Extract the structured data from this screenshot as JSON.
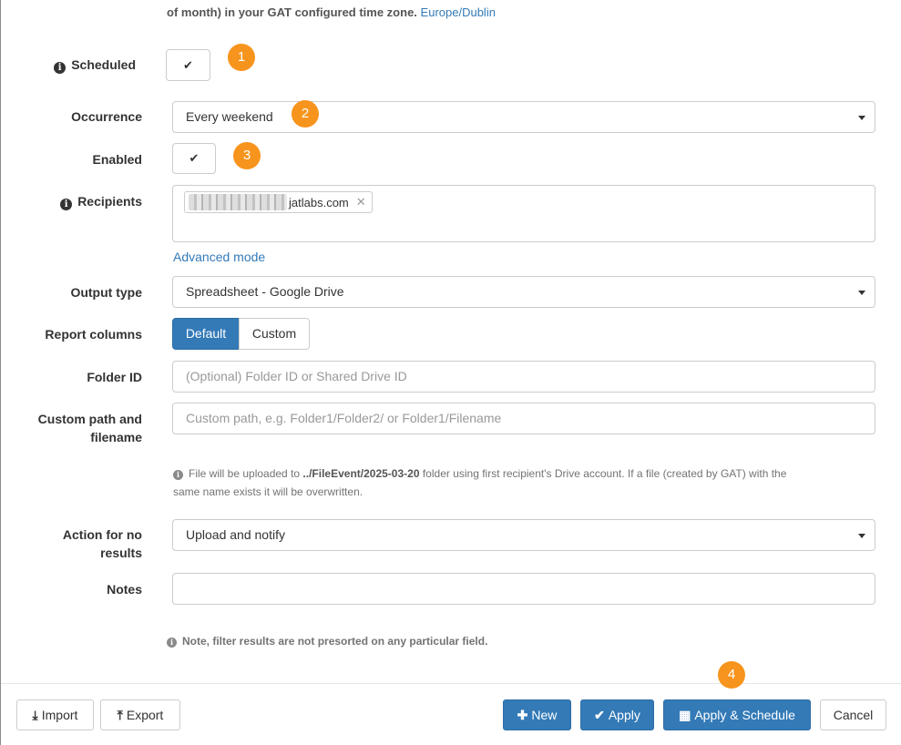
{
  "top_text": {
    "text": "of month) in your GAT configured time zone.",
    "timezone": "Europe/Dublin"
  },
  "form": {
    "scheduled": {
      "label": "Scheduled",
      "check": "✔",
      "badge": "1"
    },
    "occurrence": {
      "label": "Occurrence",
      "value": "Every weekend",
      "badge": "2"
    },
    "enabled": {
      "label": "Enabled",
      "check": "✔",
      "badge": "3"
    },
    "recipients": {
      "label": "Recipients",
      "chip_visible_text": "jatlabs.com",
      "chip_remove": "✕"
    },
    "advanced_mode": "Advanced mode",
    "output_type": {
      "label": "Output type",
      "value": "Spreadsheet - Google Drive"
    },
    "report_columns": {
      "label": "Report columns",
      "options": [
        "Default",
        "Custom"
      ],
      "selected": "Default"
    },
    "folder_id": {
      "label": "Folder ID",
      "placeholder": "(Optional) Folder ID or Shared Drive ID"
    },
    "custom_path": {
      "label_line1": "Custom path and",
      "label_line2": "filename",
      "placeholder": "Custom path, e.g. Folder1/Folder2/ or Folder1/Filename"
    },
    "upload_hint": {
      "prefix": "File will be uploaded to",
      "path": "../FileEvent/2025-03-20",
      "suffix_line1": "folder using first recipient's Drive account. If a file (created by GAT) with the",
      "line2": "same name exists it will be overwritten."
    },
    "action_no_results": {
      "label_line1": "Action for no",
      "label_line2": "results",
      "value": "Upload and notify"
    },
    "notes": {
      "label": "Notes",
      "value": ""
    },
    "sort_note": "Note, filter results are not presorted on any particular field."
  },
  "footer": {
    "import": "Import",
    "export": "Export",
    "new": "New",
    "apply": "Apply",
    "apply_schedule": "Apply & Schedule",
    "cancel": "Cancel",
    "badge": "4"
  },
  "colors": {
    "primary": "#337ab7",
    "badge": "#f7941d",
    "border": "#cccccc"
  }
}
